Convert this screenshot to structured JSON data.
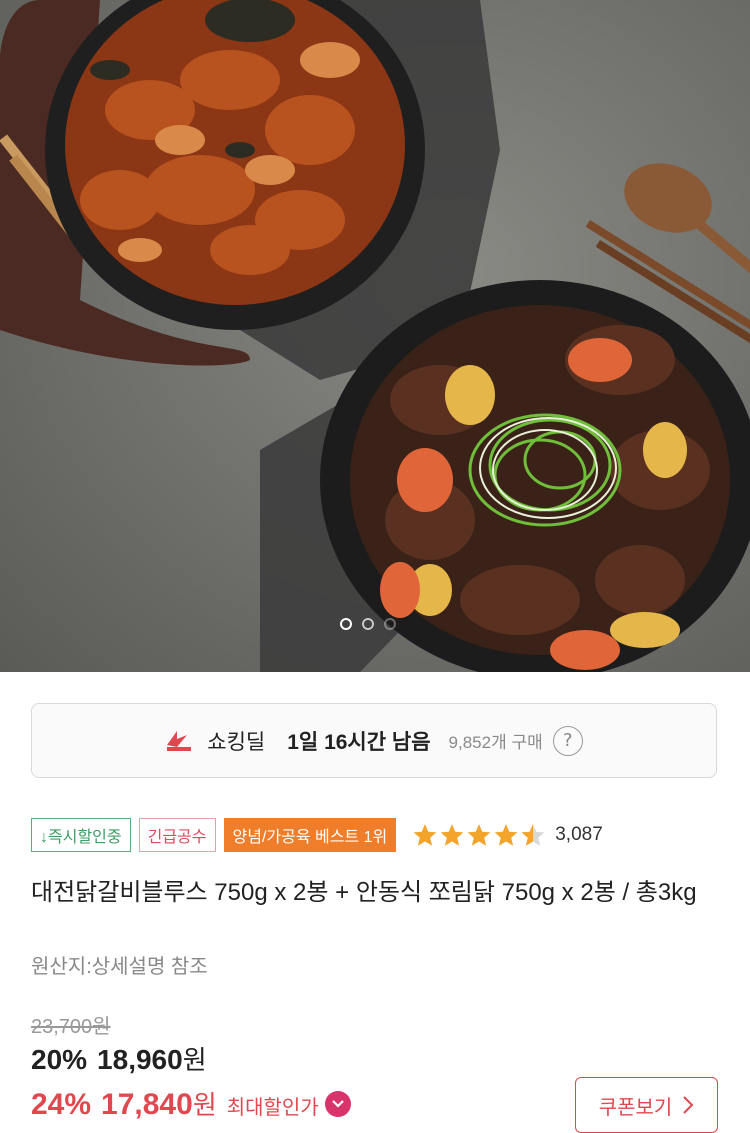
{
  "hero": {
    "image_description": "",
    "carousel": {
      "active_index": 0,
      "total": 3
    }
  },
  "deal": {
    "icon": "shocking-deal-icon",
    "name": "쇼킹딜",
    "time_left": "1일 16시간 남음",
    "purchase_count": "9,852개 구매",
    "help_icon": "?"
  },
  "badges": {
    "instant_discount": "↓즉시할인중",
    "urgent": "긴급공수",
    "best": "양념/가공육 베스트 1위"
  },
  "rating": {
    "stars": 4.5,
    "review_count": "3,087"
  },
  "product": {
    "title": "대전닭갈비블루스 750g x 2봉 + 안동식 쪼림닭 750g x 2봉 / 총3kg",
    "origin": "원산지:상세설명 참조"
  },
  "price": {
    "original": "23,700원",
    "sale_rate": "20%",
    "sale_price": "18,960",
    "sale_unit": "원",
    "max_rate": "24%",
    "max_price": "17,840",
    "max_unit": "원",
    "max_label": "최대할인가"
  },
  "coupon": {
    "label": "쿠폰보기",
    "icon": "chevron-right-icon"
  },
  "colors": {
    "accent_red": "#e0484f",
    "badge_green": "#52b27a",
    "badge_orange": "#f07d2a",
    "star": "#f2a52a"
  }
}
